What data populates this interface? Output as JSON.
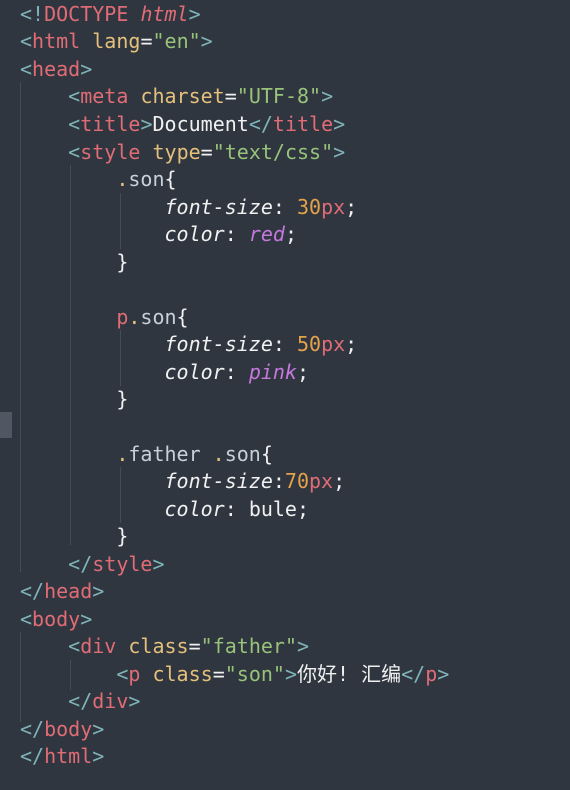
{
  "code_lines": [
    "<!DOCTYPE html>",
    "<html lang=\"en\">",
    "<head>",
    "    <meta charset=\"UTF-8\">",
    "    <title>Document</title>",
    "    <style type=\"text/css\">",
    "        .son{",
    "            font-size: 30px;",
    "            color: red;",
    "        }",
    "",
    "        p.son{",
    "            font-size: 50px;",
    "            color: pink;",
    "        }",
    "",
    "        .father .son{",
    "            font-size:70px;",
    "            color: bule;",
    "        }",
    "    </style>",
    "</head>",
    "<body>",
    "    <div class=\"father\">",
    "        <p class=\"son\">你好! 汇编</p>",
    "    </div>",
    "</body>",
    "</html>"
  ],
  "colors": {
    "background": "#2f3640",
    "tag": "#e06c75",
    "attribute": "#e5c07b",
    "string": "#98c379",
    "number": "#e5a24a",
    "keyword_value": "#c678dd",
    "punctuation": "#7fb4b8"
  }
}
